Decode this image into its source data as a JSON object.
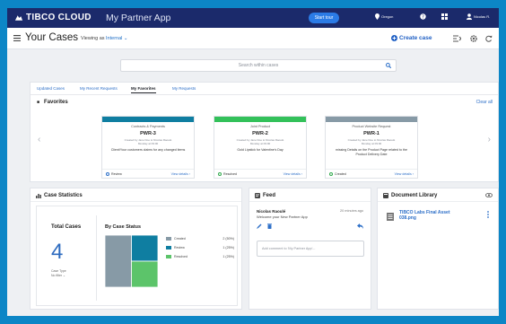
{
  "topbar": {
    "brand": "TIBCO CLOUD",
    "app_name": "My Partner App",
    "start_tour": "Start tour",
    "region": "Oregon",
    "user": "Nicolas R."
  },
  "header": {
    "title": "Your Cases",
    "viewing_label": "Viewing as",
    "viewing_value": "Internal",
    "create_case": "Create case"
  },
  "search": {
    "placeholder": "Search within cases"
  },
  "favorites": {
    "tabs": [
      "Updated Cases",
      "My Recent Requests",
      "My Favorites",
      "My Requests"
    ],
    "active_tab": 2,
    "title": "Favorites",
    "clear_all": "Clear all",
    "cards": [
      {
        "category": "Contracts & Payments",
        "number": "PWR-3",
        "meta1": "Created by Jane Doe to Nicolas Raoulé",
        "meta2": "Monday at 09:00",
        "description": "Client/Your customers claims for any changed items",
        "status": "Review",
        "status_color": "#2d6fc8",
        "details": "View details",
        "color": "#0f7ea1"
      },
      {
        "category": "Joint Product",
        "number": "PWR-2",
        "meta1": "Created by Jane Doe to Nicolas Raoulé",
        "meta2": "Monday at 09:00",
        "description": "Gold Lipstick for Valentine's Day",
        "status": "Resolved",
        "status_color": "#2ea84a",
        "details": "View details",
        "color": "#33c15a"
      },
      {
        "category": "Product Website Request",
        "number": "PWR-1",
        "meta1": "Created by Jane Doe to Nicolas Raoulé",
        "meta2": "Monday at 09:00",
        "description": "missing Details on the Product Page related to the Product Delivery Date",
        "status": "Created",
        "status_color": "#2ea84a",
        "details": "View details",
        "color": "#879aa6"
      }
    ]
  },
  "case_statistics": {
    "title": "Case Statistics",
    "total_label": "Total Cases",
    "total_value": "4",
    "sub_label": "Case Type",
    "sub_value": "No filter",
    "by_status_title": "By Case Status",
    "chart_data": {
      "type": "heatmap",
      "title": "By Case Status",
      "series": [
        {
          "name": "Created",
          "value": 2,
          "share": "50%",
          "color": "#879aa6"
        },
        {
          "name": "Review",
          "value": 1,
          "share": "25%",
          "color": "#0f7ea1"
        },
        {
          "name": "Resolved",
          "value": 1,
          "share": "25%",
          "color": "#5cc46a"
        }
      ]
    }
  },
  "feed": {
    "title": "Feed",
    "author": "Nicolas Raoulé",
    "message": "Welcome your New Partner App",
    "time": "20 minutes ago",
    "comment_placeholder": "Add comment to 'My Partner App'..."
  },
  "document_library": {
    "title": "Document Library",
    "document": "TIBCO Labs Final Asset 038.png"
  }
}
